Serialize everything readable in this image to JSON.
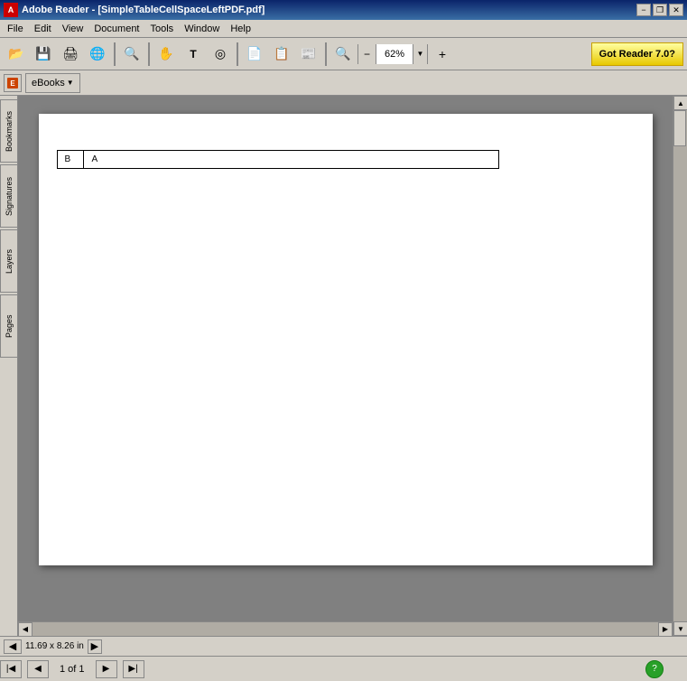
{
  "titleBar": {
    "appName": "Adobe Reader",
    "fileName": "SimpleTableCellSpaceLeftPDF.pdf",
    "fullTitle": "Adobe Reader - [SimpleTableCellSpaceLeftPDF.pdf]",
    "minimizeBtn": "−",
    "restoreBtn": "❐",
    "closeBtn": "✕",
    "innerMinBtn": "−",
    "innerRestBtn": "❐",
    "innerCloseBtn": "✕"
  },
  "menuBar": {
    "items": [
      "File",
      "Edit",
      "View",
      "Document",
      "Tools",
      "Window",
      "Help"
    ]
  },
  "toolbar": {
    "buttons": [
      {
        "name": "open-btn",
        "icon": "📂"
      },
      {
        "name": "save-btn",
        "icon": "💾"
      },
      {
        "name": "print-btn",
        "icon": "🖨"
      },
      {
        "name": "email-btn",
        "icon": "🌐"
      },
      {
        "name": "search-btn",
        "icon": "🔍"
      },
      {
        "name": "hand-btn",
        "icon": "✋"
      },
      {
        "name": "select-btn",
        "icon": "T"
      },
      {
        "name": "snapshot-btn",
        "icon": "◎"
      }
    ],
    "zoomMinus": "−",
    "zoomPlus": "+",
    "zoomValue": "62%",
    "zoomDropdown": "▼",
    "pageViewBtns": [
      "📄",
      "📋",
      "📰"
    ],
    "gotReaderLabel": "Got Reader 7.0?"
  },
  "toolbar2": {
    "ebooksLabel": "eBooks",
    "ebooksDropdown": "▼"
  },
  "sidebar": {
    "tabs": [
      "Bookmarks",
      "Signatures",
      "Layers",
      "Pages"
    ]
  },
  "pdfPage": {
    "table": {
      "rows": [
        {
          "col1": "B",
          "col2": "A"
        }
      ]
    }
  },
  "statusBar": {
    "dimensions": "11.69 x 8.26 in"
  },
  "navBar": {
    "firstPageBtn": "◀◀",
    "prevPageBtn": "◀",
    "pageInfo": "1 of 1",
    "nextPageBtn": "▶",
    "lastPageBtn": "▶▶",
    "helpBtn": "?"
  }
}
